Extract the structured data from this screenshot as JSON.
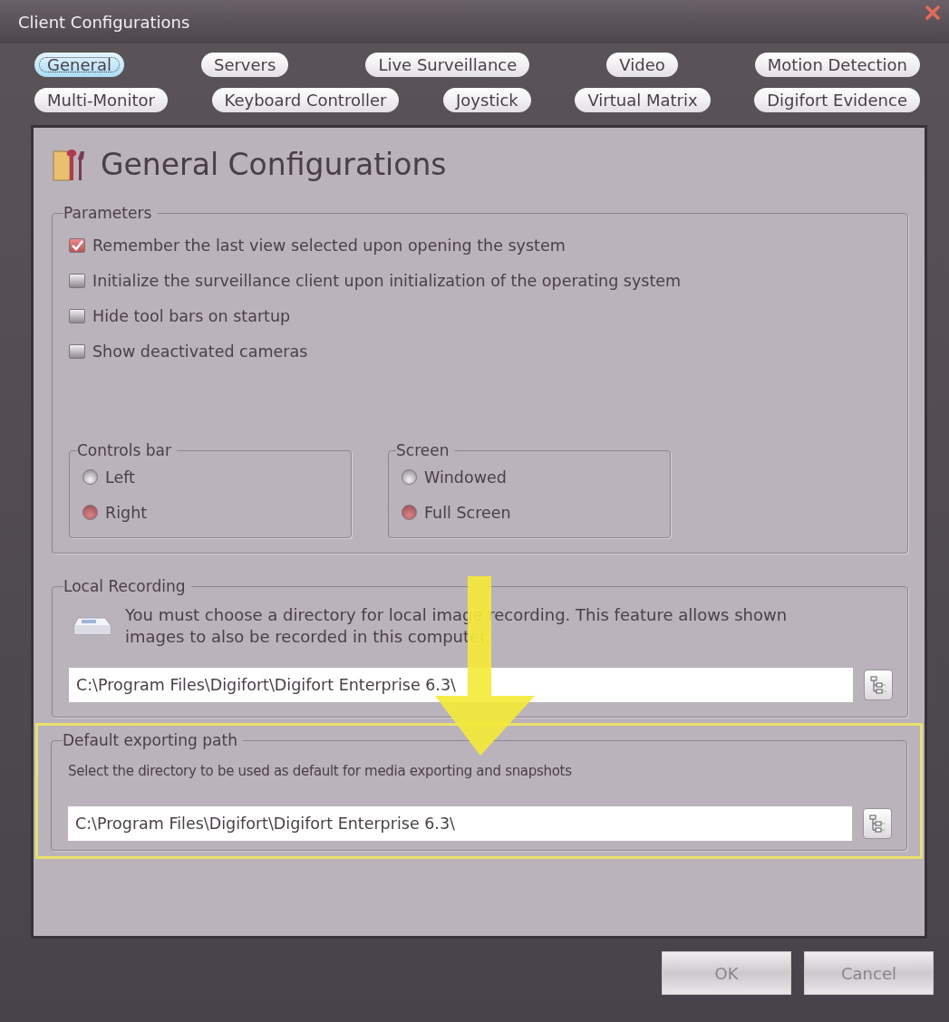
{
  "window": {
    "title": "Client Configurations"
  },
  "tabs": [
    [
      {
        "label": "General",
        "selected": true
      },
      {
        "label": "Servers",
        "selected": false
      },
      {
        "label": "Live Surveillance",
        "selected": false
      },
      {
        "label": "Video",
        "selected": false
      },
      {
        "label": "Motion Detection",
        "selected": false
      }
    ],
    [
      {
        "label": "Multi-Monitor",
        "selected": false
      },
      {
        "label": "Keyboard Controller",
        "selected": false
      },
      {
        "label": "Joystick",
        "selected": false
      },
      {
        "label": "Virtual Matrix",
        "selected": false
      },
      {
        "label": "Digifort Evidence",
        "selected": false
      }
    ]
  ],
  "heading": "General Configurations",
  "parameters": {
    "title": "Parameters",
    "options": [
      {
        "label": "Remember the last view selected upon opening the system",
        "checked": true
      },
      {
        "label": "Initialize the surveillance client upon initialization of the operating system",
        "checked": false
      },
      {
        "label": "Hide tool bars on startup",
        "checked": false
      },
      {
        "label": "Show deactivated cameras",
        "checked": false
      }
    ]
  },
  "radio_groups": [
    {
      "title": "Controls bar",
      "options": [
        {
          "label": "Left",
          "selected": false
        },
        {
          "label": "Right",
          "selected": true
        }
      ]
    },
    {
      "title": "Screen",
      "options": [
        {
          "label": "Windowed",
          "selected": false
        },
        {
          "label": "Full Screen",
          "selected": true
        }
      ]
    }
  ],
  "local_recording": {
    "title": "Local Recording",
    "description": "You must choose a directory for local image recording. This feature allows shown images to also be recorded in this computer.",
    "path": "C:\\Program Files\\Digifort\\Digifort Enterprise 6.3\\"
  },
  "default_export": {
    "title": "Default exporting path",
    "description": "Select the directory to be used as default for media exporting and snapshots",
    "path": "C:\\Program Files\\Digifort\\Digifort Enterprise 6.3\\",
    "highlighted": true
  },
  "buttons": [
    {
      "label": "OK"
    },
    {
      "label": "Cancel"
    }
  ]
}
